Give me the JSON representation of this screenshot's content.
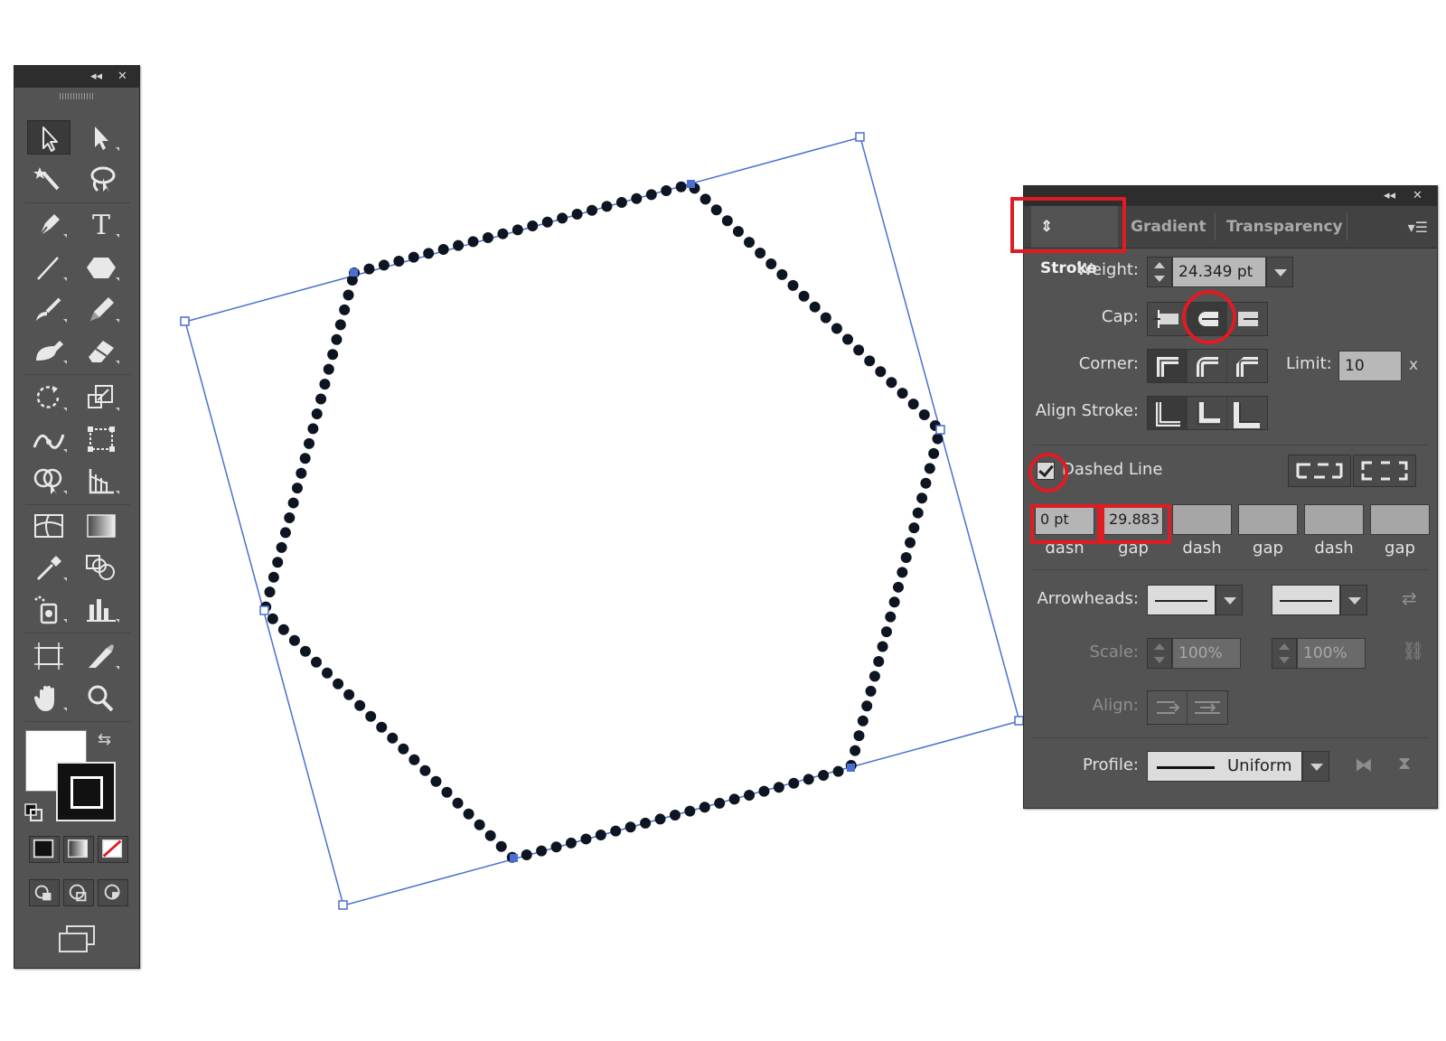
{
  "tools_panel": {
    "collapse_glyph": "◂◂",
    "close_glyph": "✕",
    "tools": [
      {
        "id": "selection",
        "name": "selection-tool-icon"
      },
      {
        "id": "direct-selection",
        "name": "direct-selection-tool-icon"
      },
      {
        "id": "magic-wand",
        "name": "magic-wand-tool-icon"
      },
      {
        "id": "lasso",
        "name": "lasso-tool-icon"
      },
      {
        "id": "pen",
        "name": "pen-tool-icon"
      },
      {
        "id": "type",
        "name": "type-tool-icon",
        "glyph": "T"
      },
      {
        "id": "line",
        "name": "line-segment-tool-icon"
      },
      {
        "id": "polygon",
        "name": "polygon-tool-icon"
      },
      {
        "id": "paintbrush",
        "name": "paintbrush-tool-icon"
      },
      {
        "id": "pencil",
        "name": "pencil-tool-icon"
      },
      {
        "id": "blob-brush",
        "name": "blob-brush-tool-icon"
      },
      {
        "id": "eraser",
        "name": "eraser-tool-icon"
      },
      {
        "id": "rotate",
        "name": "rotate-tool-icon"
      },
      {
        "id": "scale",
        "name": "scale-tool-icon"
      },
      {
        "id": "width",
        "name": "width-tool-icon"
      },
      {
        "id": "free-transform",
        "name": "free-transform-tool-icon"
      },
      {
        "id": "shape-builder",
        "name": "shape-builder-tool-icon"
      },
      {
        "id": "perspective-grid",
        "name": "perspective-grid-tool-icon"
      },
      {
        "id": "mesh",
        "name": "mesh-tool-icon"
      },
      {
        "id": "gradient",
        "name": "gradient-tool-icon"
      },
      {
        "id": "eyedropper",
        "name": "eyedropper-tool-icon"
      },
      {
        "id": "blend",
        "name": "blend-tool-icon"
      },
      {
        "id": "symbol-sprayer",
        "name": "symbol-sprayer-tool-icon"
      },
      {
        "id": "column-graph",
        "name": "column-graph-tool-icon"
      },
      {
        "id": "artboard",
        "name": "artboard-tool-icon"
      },
      {
        "id": "slice",
        "name": "slice-tool-icon"
      },
      {
        "id": "hand",
        "name": "hand-tool-icon"
      },
      {
        "id": "zoom",
        "name": "zoom-tool-icon"
      }
    ],
    "fill_color": "#ffffff",
    "stroke_color": "#111111",
    "swap_glyph": "⇆"
  },
  "stroke_panel": {
    "collapse_glyph": "◂◂",
    "close_glyph": "✕",
    "tabs": [
      {
        "label": "Stroke",
        "prefix": "⇕",
        "active": true
      },
      {
        "label": "Gradient",
        "active": false
      },
      {
        "label": "Transparency",
        "active": false
      }
    ],
    "menu_glyph": "▾☰",
    "weight": {
      "label": "Weight:",
      "value": "24.349 pt"
    },
    "cap": {
      "label": "Cap:",
      "selected": "round-cap"
    },
    "corner": {
      "label": "Corner:",
      "limit_label": "Limit:",
      "limit_value": "10",
      "limit_unit": "x"
    },
    "align_stroke": {
      "label": "Align Stroke:"
    },
    "dashed_line": {
      "label": "Dashed Line",
      "checked": true
    },
    "dash_fields": [
      {
        "value": "0 pt",
        "label": "dash"
      },
      {
        "value": "29.883",
        "label": "gap"
      },
      {
        "value": "",
        "label": "dash"
      },
      {
        "value": "",
        "label": "gap"
      },
      {
        "value": "",
        "label": "dash"
      },
      {
        "value": "",
        "label": "gap"
      }
    ],
    "arrowheads": {
      "label": "Arrowheads:"
    },
    "scale": {
      "label": "Scale:",
      "start": "100%",
      "end": "100%"
    },
    "align": {
      "label": "Align:"
    },
    "profile": {
      "label": "Profile:",
      "value": "Uniform"
    }
  },
  "colors": {
    "highlight": "#e11b22",
    "selection_blue": "#4a6fd0",
    "panel_bg": "#535353"
  }
}
